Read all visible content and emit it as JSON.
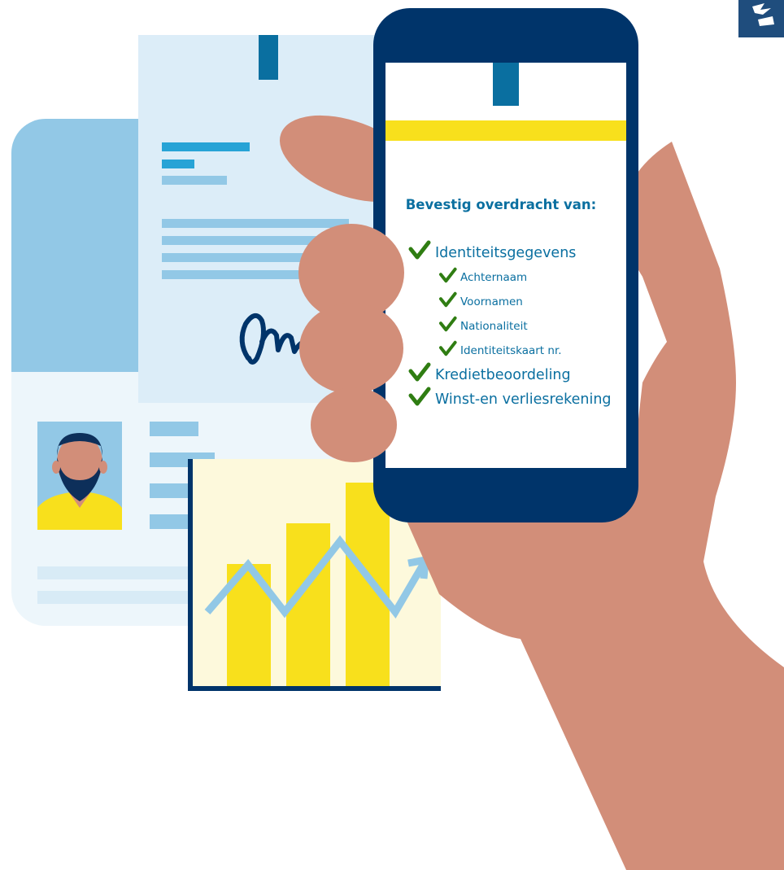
{
  "colors": {
    "navy": "#00346a",
    "accent_blue": "#0a6fa0",
    "yellow": "#f8e01c",
    "check_green": "#2f7d12",
    "skin": "#d28e79",
    "light_blue": "#92c8e6",
    "paper_blue": "#dcedf8",
    "chart_bg": "#fdf9dc"
  },
  "phone": {
    "heading": "Bevestig overdracht van:",
    "items": [
      {
        "label": "Identiteitsgegevens",
        "level": 1,
        "checked": true
      },
      {
        "label": "Achternaam",
        "level": 2,
        "checked": true
      },
      {
        "label": "Voornamen",
        "level": 2,
        "checked": true
      },
      {
        "label": "Nationaliteit",
        "level": 2,
        "checked": true
      },
      {
        "label": "Identiteitskaart nr.",
        "level": 2,
        "checked": true
      },
      {
        "label": "Kredietbeoordeling",
        "level": 1,
        "checked": true
      },
      {
        "label": "Winst-en verliesrekening",
        "level": 1,
        "checked": true
      }
    ]
  },
  "chart_data": {
    "type": "bar",
    "values": [
      3,
      4,
      5
    ],
    "trend": [
      2,
      4,
      2,
      5,
      2,
      4
    ],
    "title": "",
    "xlabel": "",
    "ylabel": ""
  },
  "icons": {
    "corner_logo": "logo-icon",
    "check": "checkmark-icon",
    "avatar": "person-icon",
    "signature": "signature-icon",
    "arrow": "trend-arrow-icon"
  }
}
